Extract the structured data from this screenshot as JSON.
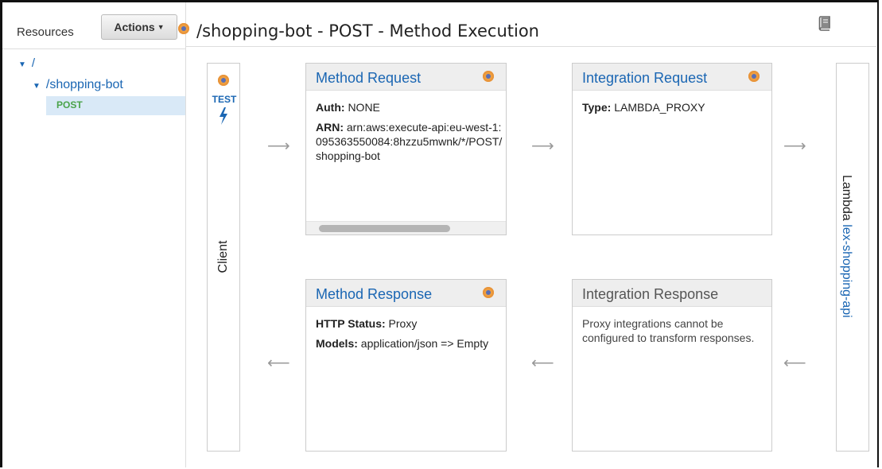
{
  "sidebar": {
    "resources_label": "Resources",
    "actions_label": "Actions",
    "tree": {
      "root": "/",
      "child": "/shopping-bot",
      "method": "POST"
    }
  },
  "header": {
    "title": "/shopping-bot - POST - Method Execution"
  },
  "client": {
    "test_label": "TEST",
    "label": "Client"
  },
  "lambda": {
    "label": "Lambda",
    "function": "lex-shopping-api"
  },
  "method_request": {
    "title": "Method Request",
    "auth_key": "Auth:",
    "auth_value": "NONE",
    "arn_key": "ARN:",
    "arn_value": "arn:aws:execute-api:eu-west-1:095363550084:8hzzu5mwnk/*/POST/shopping-bot"
  },
  "integration_request": {
    "title": "Integration Request",
    "type_key": "Type:",
    "type_value": "LAMBDA_PROXY"
  },
  "method_response": {
    "title": "Method Response",
    "status_key": "HTTP Status:",
    "status_value": "Proxy",
    "models_key": "Models:",
    "models_value": "application/json => Empty"
  },
  "integration_response": {
    "title": "Integration Response",
    "message": "Proxy integrations cannot be configured to transform responses."
  },
  "colors": {
    "link_blue": "#1a66b3",
    "method_green": "#4aa34a",
    "selected_bg": "#d9e9f7",
    "indicator_orange": "#f0a040"
  },
  "icons": [
    "resource-indicator-icon",
    "book-icon",
    "lightning-bolt-icon",
    "arrow-right-icon",
    "arrow-left-icon",
    "caret-down-icon"
  ]
}
